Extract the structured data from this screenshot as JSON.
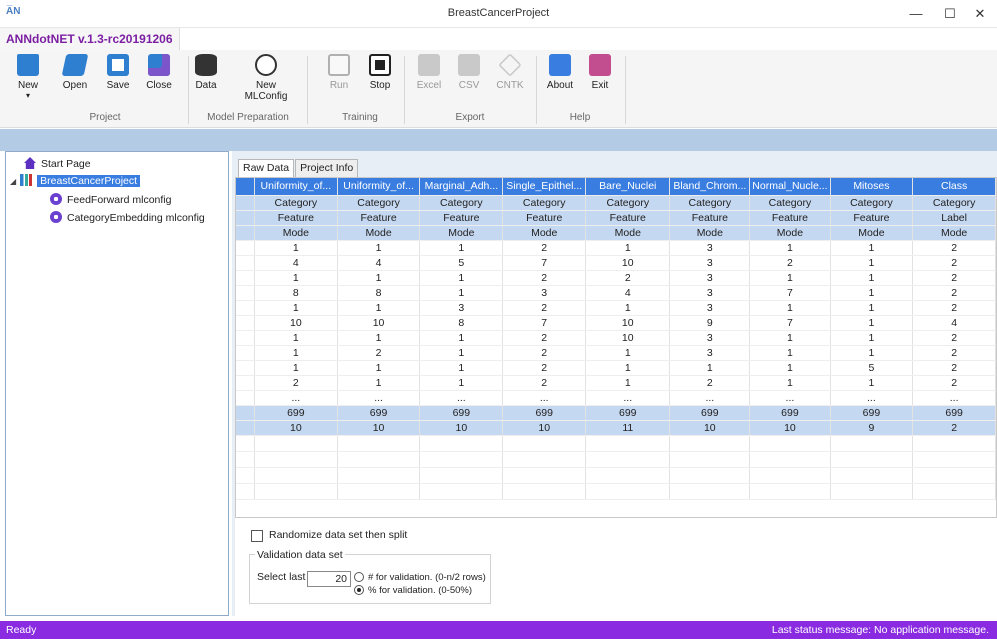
{
  "window": {
    "title": "BreastCancerProject",
    "minimize": "—",
    "maximize": "☐",
    "close": "✕",
    "logo": "A̅N"
  },
  "app": {
    "name": "ANNdotNET v.1.3-rc20191206"
  },
  "ribbon": {
    "buttons": [
      {
        "label": "New",
        "sub": "▾"
      },
      {
        "label": "Open"
      },
      {
        "label": "Save"
      },
      {
        "label": "Close"
      },
      {
        "label": "Data"
      },
      {
        "label": "New",
        "sub": "MLConfig"
      },
      {
        "label": "Run"
      },
      {
        "label": "Stop"
      },
      {
        "label": "Excel"
      },
      {
        "label": "CSV"
      },
      {
        "label": "CNTK"
      },
      {
        "label": "About"
      },
      {
        "label": "Exit"
      }
    ],
    "groups": [
      "Project",
      "Model Preparation",
      "Training",
      "Export",
      "Help"
    ]
  },
  "tree": {
    "start_page": "Start Page",
    "project": "BreastCancerProject",
    "configs": [
      "FeedForward mlconfig",
      "CategoryEmbedding mlconfig"
    ]
  },
  "tabs": [
    "Raw Data",
    "Project Info"
  ],
  "grid": {
    "columns": [
      "",
      "Uniformity_of...",
      "Uniformity_of...",
      "Marginal_Adh...",
      "Single_Epithel...",
      "Bare_Nuclei",
      "Bland_Chrom...",
      "Normal_Nucle...",
      "Mitoses",
      "Class"
    ],
    "meta_rows": [
      [
        "",
        "Category",
        "Category",
        "Category",
        "Category",
        "Category",
        "Category",
        "Category",
        "Category",
        "Category"
      ],
      [
        "",
        "Feature",
        "Feature",
        "Feature",
        "Feature",
        "Feature",
        "Feature",
        "Feature",
        "Feature",
        "Label"
      ],
      [
        "",
        "Mode",
        "Mode",
        "Mode",
        "Mode",
        "Mode",
        "Mode",
        "Mode",
        "Mode",
        "Mode"
      ]
    ],
    "data_rows": [
      [
        "",
        "1",
        "1",
        "1",
        "2",
        "1",
        "3",
        "1",
        "1",
        "2"
      ],
      [
        "",
        "4",
        "4",
        "5",
        "7",
        "10",
        "3",
        "2",
        "1",
        "2"
      ],
      [
        "",
        "1",
        "1",
        "1",
        "2",
        "2",
        "3",
        "1",
        "1",
        "2"
      ],
      [
        "",
        "8",
        "8",
        "1",
        "3",
        "4",
        "3",
        "7",
        "1",
        "2"
      ],
      [
        "",
        "1",
        "1",
        "3",
        "2",
        "1",
        "3",
        "1",
        "1",
        "2"
      ],
      [
        "",
        "10",
        "10",
        "8",
        "7",
        "10",
        "9",
        "7",
        "1",
        "4"
      ],
      [
        "",
        "1",
        "1",
        "1",
        "2",
        "10",
        "3",
        "1",
        "1",
        "2"
      ],
      [
        "",
        "1",
        "2",
        "1",
        "2",
        "1",
        "3",
        "1",
        "1",
        "2"
      ],
      [
        "",
        "1",
        "1",
        "1",
        "2",
        "1",
        "1",
        "1",
        "5",
        "2"
      ],
      [
        "",
        "2",
        "1",
        "1",
        "2",
        "1",
        "2",
        "1",
        "1",
        "2"
      ],
      [
        "",
        "...",
        "...",
        "...",
        "...",
        "...",
        "...",
        "...",
        "...",
        "..."
      ]
    ],
    "stat_rows": [
      [
        "",
        "699",
        "699",
        "699",
        "699",
        "699",
        "699",
        "699",
        "699",
        "699"
      ],
      [
        "",
        "10",
        "10",
        "10",
        "10",
        "11",
        "10",
        "10",
        "9",
        "2"
      ]
    ]
  },
  "options": {
    "randomize": "Randomize data set then split",
    "validation_title": "Validation data set",
    "select_last": "Select last",
    "count": "20",
    "radio_rows": "# for validation. (0-n/2 rows)",
    "radio_percent": "% for validation. (0-50%)"
  },
  "status": {
    "left": "Ready",
    "right": "Last status message: No application message."
  },
  "colors": {
    "accent": "#3a7de0",
    "status_bar": "#8a2be2",
    "app_name": "#7b1fa2"
  }
}
